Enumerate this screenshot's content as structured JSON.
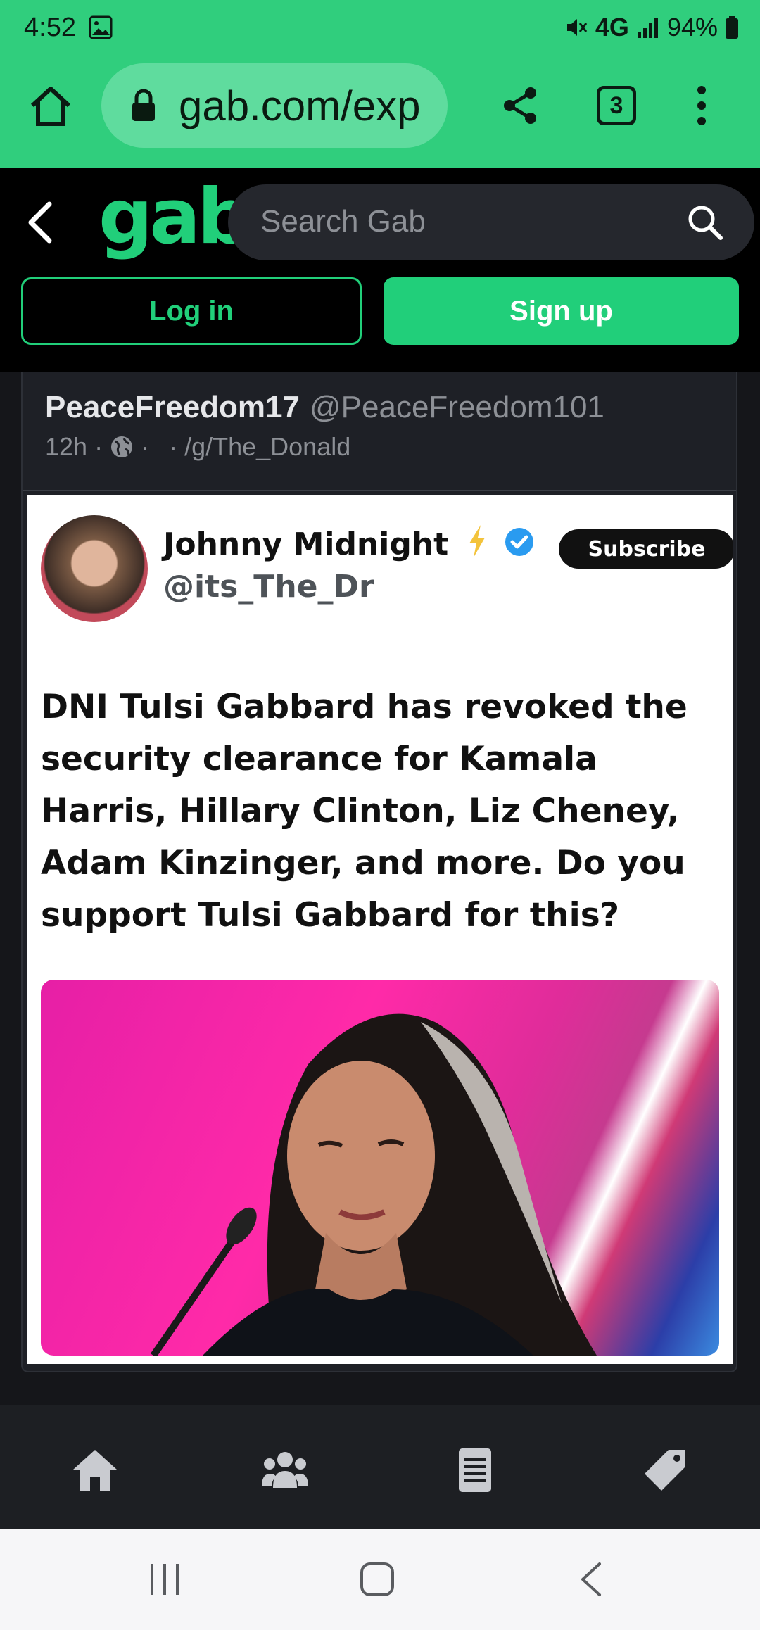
{
  "status_bar": {
    "time": "4:52",
    "network": "4G",
    "battery": "94%"
  },
  "browser": {
    "url": "gab.com/exp",
    "tab_count": "3"
  },
  "gab": {
    "logo": "gab",
    "search_placeholder": "Search Gab",
    "login_label": "Log in",
    "signup_label": "Sign up",
    "brand_color": "#21cf7a"
  },
  "post": {
    "author_name": "PeaceFreedom17",
    "author_handle": "@PeaceFreedom101",
    "time": "12h",
    "group": "/g/The_Donald",
    "embed": {
      "name": "Johnny Midnight",
      "handle": "@its_The_Dr",
      "subscribe_label": "Subscribe",
      "text": "DNI Tulsi Gabbard has revoked the security clearance for Kamala Harris, Hillary Clinton, Liz Cheney, Adam Kinzinger, and more.  Do you support Tulsi Gabbard for this?"
    }
  },
  "bottom_nav": {
    "items": [
      "home-icon",
      "groups-icon",
      "news-icon",
      "tag-icon"
    ]
  }
}
